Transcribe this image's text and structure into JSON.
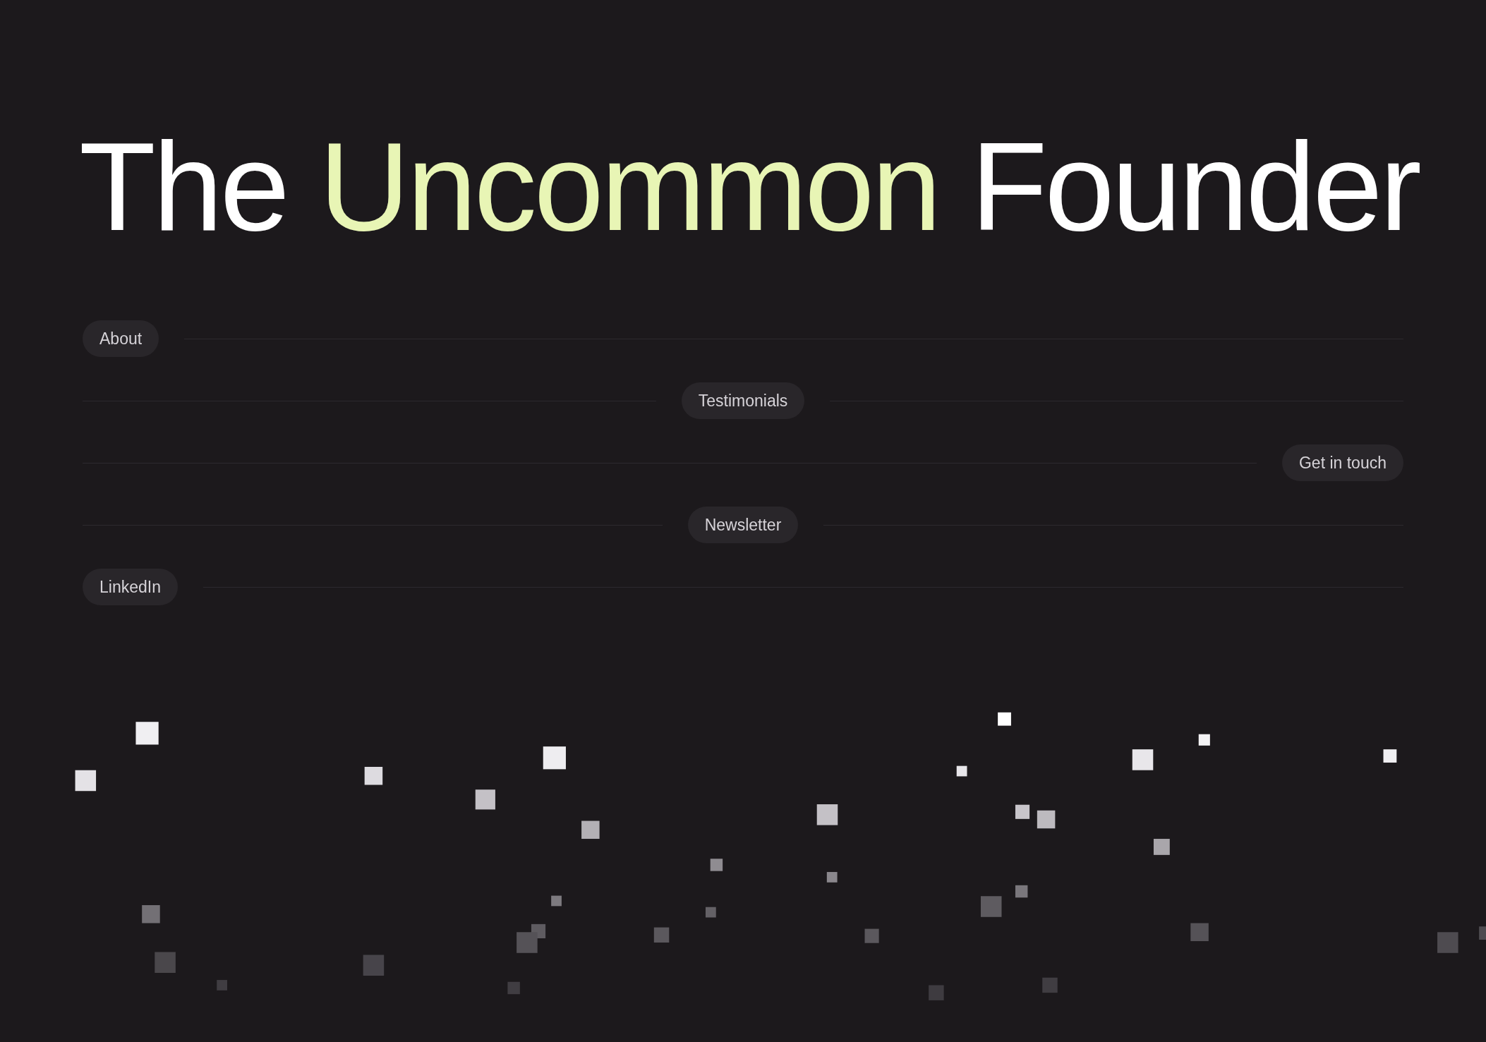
{
  "title": [
    {
      "text": "The",
      "kind": "plain"
    },
    {
      "text": "Uncommon",
      "kind": "accent"
    },
    {
      "text": "Founder",
      "kind": "plain"
    }
  ],
  "nav": [
    {
      "label": "About"
    },
    {
      "label": "Testimonials"
    },
    {
      "label": "Get in touch"
    },
    {
      "label": "Newsletter"
    },
    {
      "label": "LinkedIn"
    }
  ]
}
